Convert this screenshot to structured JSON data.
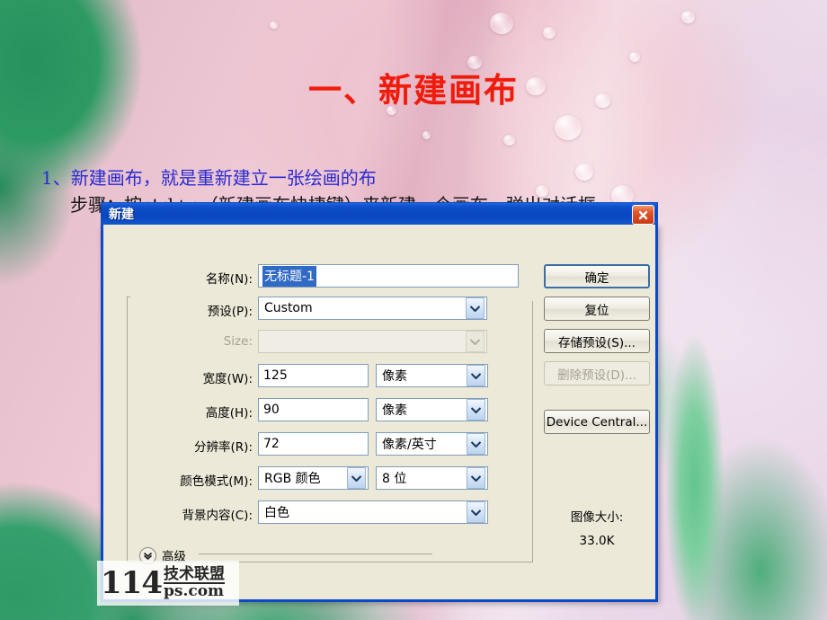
{
  "slide": {
    "title": "一、新建画布",
    "bullet_blue": "1、新建画布，就是重新建立一张绘画的布",
    "bullet_black": "步骤：按ctrl+n（新建画布快捷键）来新建一个画布。弹出对话框:",
    "title_color": "#ef1b0c",
    "bullet_blue_color": "#2a2ad0"
  },
  "watermark": {
    "number": "114",
    "cn": "技术联盟",
    "domain": "ps.com"
  },
  "dialog": {
    "title": "新建",
    "close_icon": "close-icon",
    "fields": {
      "name_label": "名称(N):",
      "name_value": "无标题-1",
      "preset_label": "预设(P):",
      "preset_value": "Custom",
      "size_label": "Size:",
      "size_value": "",
      "width_label": "宽度(W):",
      "width_value": "125",
      "width_unit": "像素",
      "height_label": "高度(H):",
      "height_value": "90",
      "height_unit": "像素",
      "resolution_label": "分辨率(R):",
      "resolution_value": "72",
      "resolution_unit": "像素/英寸",
      "colormode_label": "颜色模式(M):",
      "colormode_value": "RGB 颜色",
      "bitdepth_value": "8 位",
      "background_label": "背景内容(C):",
      "background_value": "白色"
    },
    "advanced": {
      "label": "高级",
      "chevron_icon": "chevron-down-icon"
    },
    "buttons": {
      "ok": "确定",
      "reset": "复位",
      "save_preset": "存储预设(S)...",
      "delete_preset": "删除预设(D)...",
      "device_central": "Device Central..."
    },
    "image_size": {
      "label": "图像大小:",
      "value": "33.0K"
    }
  }
}
